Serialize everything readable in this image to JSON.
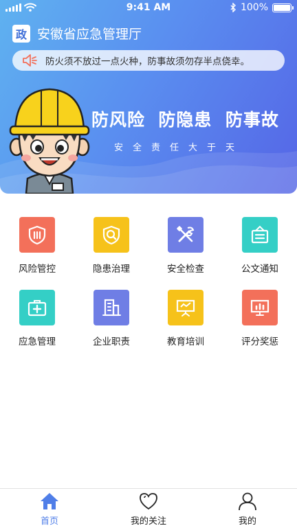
{
  "status_bar": {
    "time": "9:41 AM",
    "battery": "100%",
    "battery_level": 1.0
  },
  "header": {
    "badge": "政",
    "title": "安徽省应急管理厅",
    "notice": "防火须不放过一点火种，防事故须勿存半点侥幸。",
    "slogan": "防风险  防隐患  防事故",
    "subslogan": "安全责任大于天"
  },
  "colors": {
    "header_start": "#5fb2f0",
    "header_end": "#5565e6",
    "accent": "#4f7ee8"
  },
  "grid": [
    {
      "label": "风险管控",
      "icon": "shield-icon",
      "color": "#f3705a"
    },
    {
      "label": "隐患治理",
      "icon": "search-shield-icon",
      "color": "#f6c21a"
    },
    {
      "label": "安全检查",
      "icon": "tools-icon",
      "color": "#6f7ee5"
    },
    {
      "label": "公文通知",
      "icon": "notice-board-icon",
      "color": "#34cfc6"
    },
    {
      "label": "应急管理",
      "icon": "first-aid-kit-icon",
      "color": "#34cfc6"
    },
    {
      "label": "企业职责",
      "icon": "building-icon",
      "color": "#6f7ee5"
    },
    {
      "label": "教育培训",
      "icon": "presentation-board-icon",
      "color": "#f6c21a"
    },
    {
      "label": "评分奖惩",
      "icon": "bar-chart-icon",
      "color": "#f3705a"
    }
  ],
  "tabbar": [
    {
      "label": "首页",
      "icon": "home-icon",
      "active": true
    },
    {
      "label": "我的关注",
      "icon": "heart-icon",
      "active": false
    },
    {
      "label": "我的",
      "icon": "user-icon",
      "active": false
    }
  ]
}
